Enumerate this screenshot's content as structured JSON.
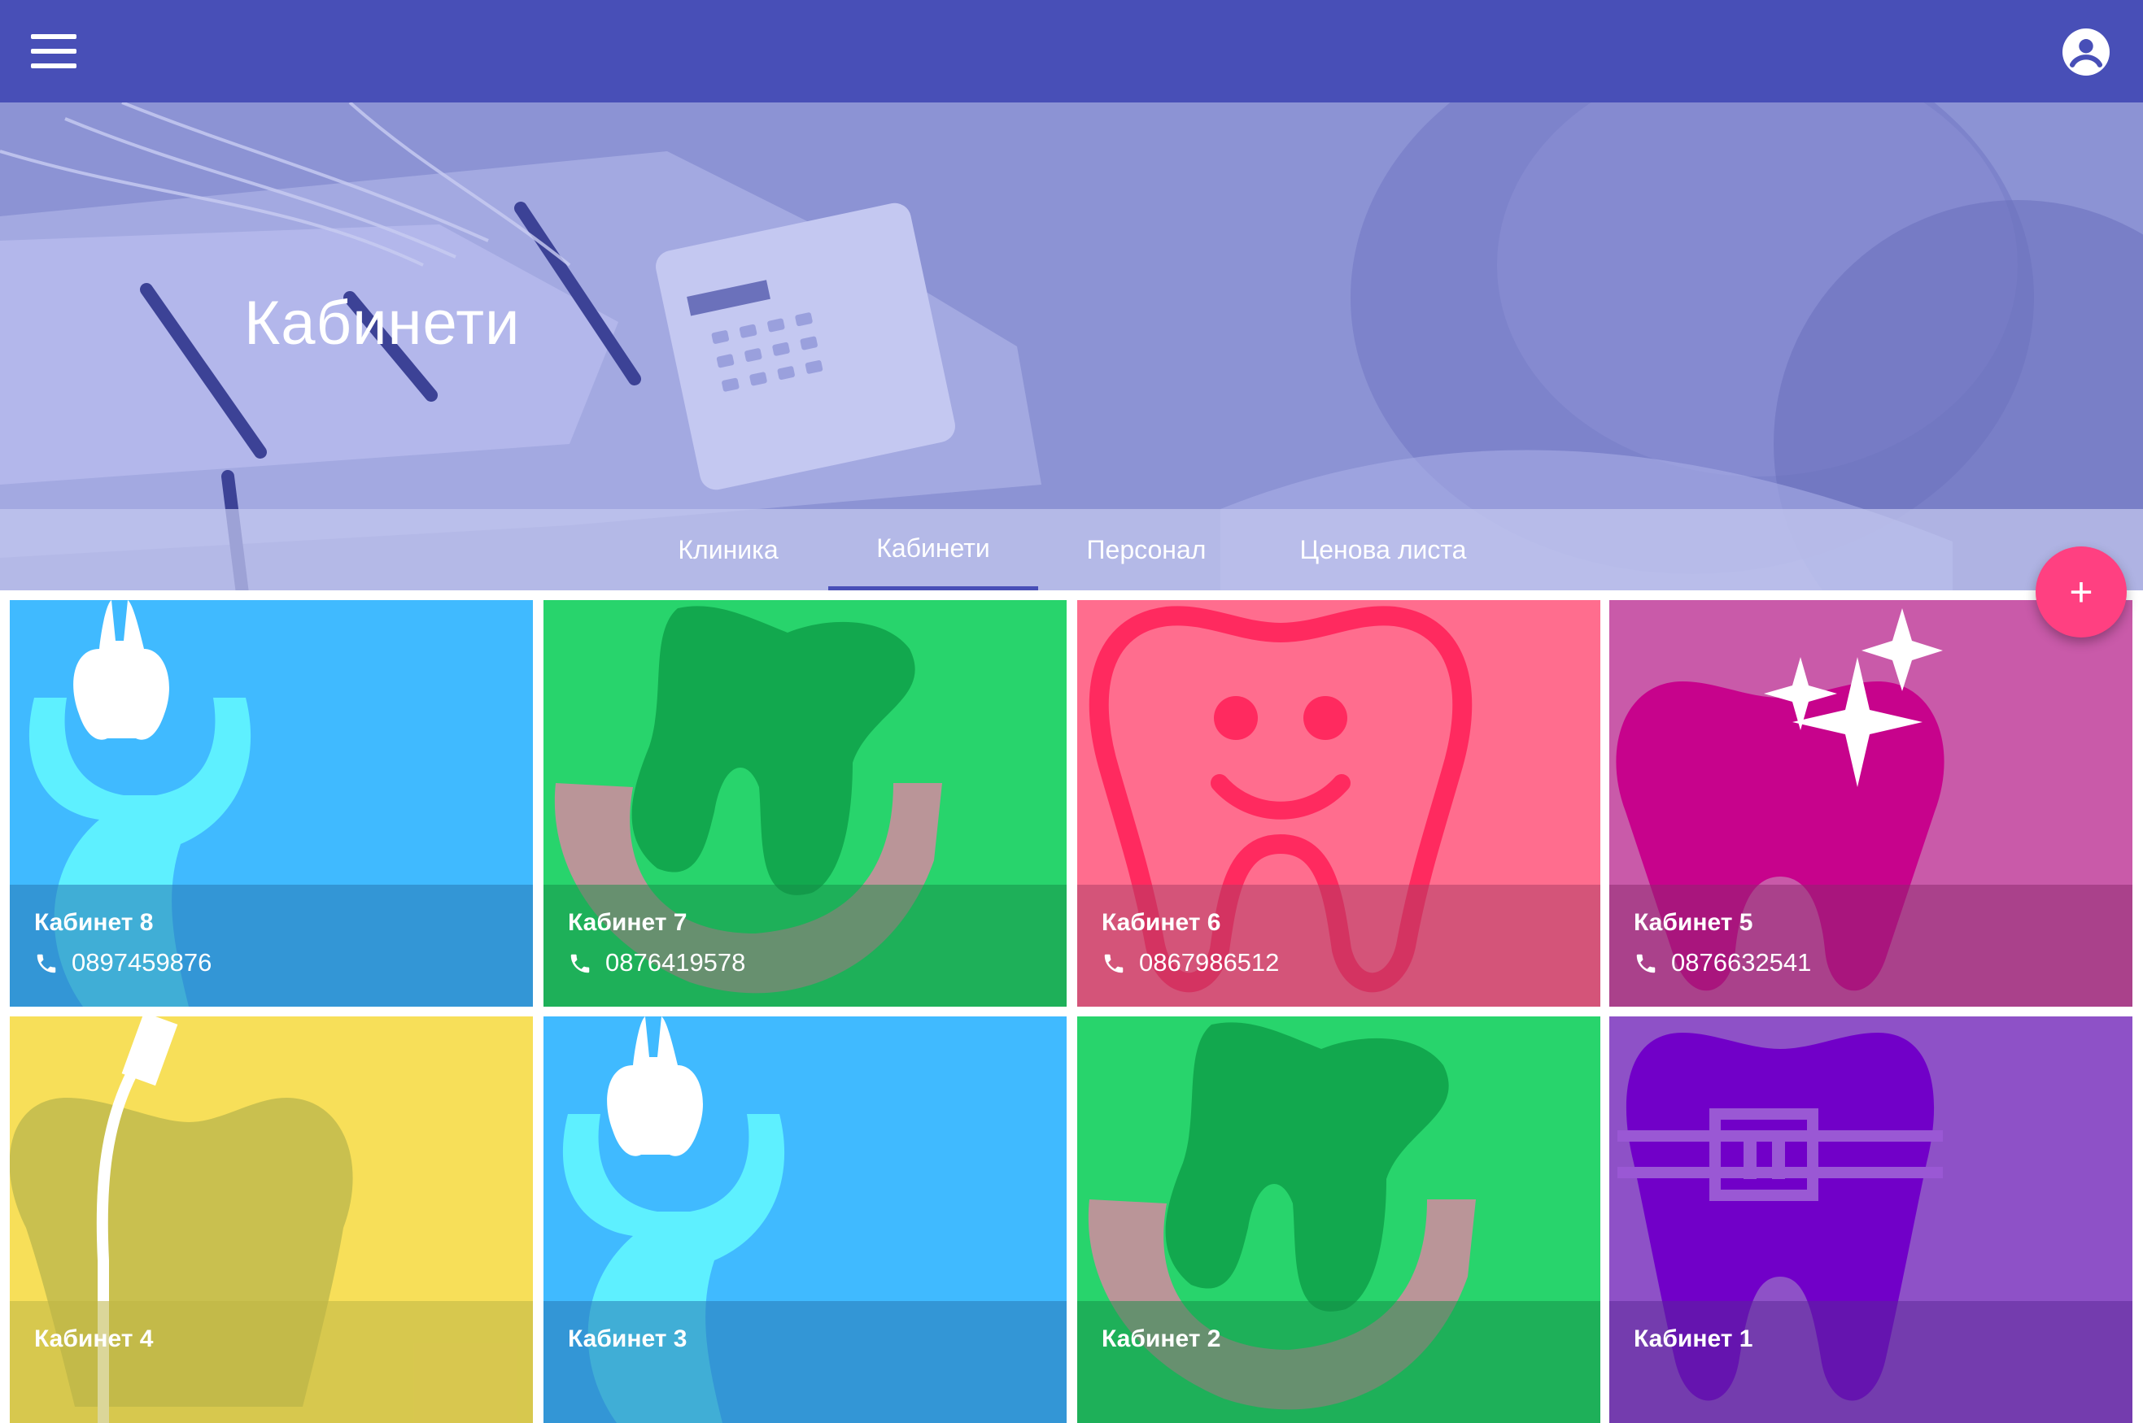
{
  "hero": {
    "title": "Кабинети"
  },
  "tabs": [
    {
      "label": "Клиника"
    },
    {
      "label": "Кабинети",
      "active": true
    },
    {
      "label": "Персонал"
    },
    {
      "label": "Ценова листа"
    }
  ],
  "fab": {
    "label": "+"
  },
  "rooms": [
    {
      "name": "Кабинет 8",
      "phone": "0897459876",
      "color": "#40baff",
      "icon": "tooth-extraction-icon"
    },
    {
      "name": "Кабинет 7",
      "phone": "0876419578",
      "color": "#28d46c",
      "icon": "tooth-gum-icon"
    },
    {
      "name": "Кабинет 6",
      "phone": "0867986512",
      "color": "#ff6d8e",
      "icon": "smiling-tooth-icon"
    },
    {
      "name": "Кабинет 5",
      "phone": "0876632541",
      "color": "#c95aa9",
      "icon": "sparkling-tooth-icon"
    },
    {
      "name": "Кабинет 4",
      "phone": "",
      "color": "#f7df59",
      "icon": "root-canal-icon"
    },
    {
      "name": "Кабинет 3",
      "phone": "",
      "color": "#40baff",
      "icon": "tooth-extraction-icon"
    },
    {
      "name": "Кабинет 2",
      "phone": "",
      "color": "#28d46c",
      "icon": "tooth-gum-icon"
    },
    {
      "name": "Кабинет 1",
      "phone": "",
      "color": "#8e51c7",
      "icon": "tooth-braces-icon"
    }
  ]
}
